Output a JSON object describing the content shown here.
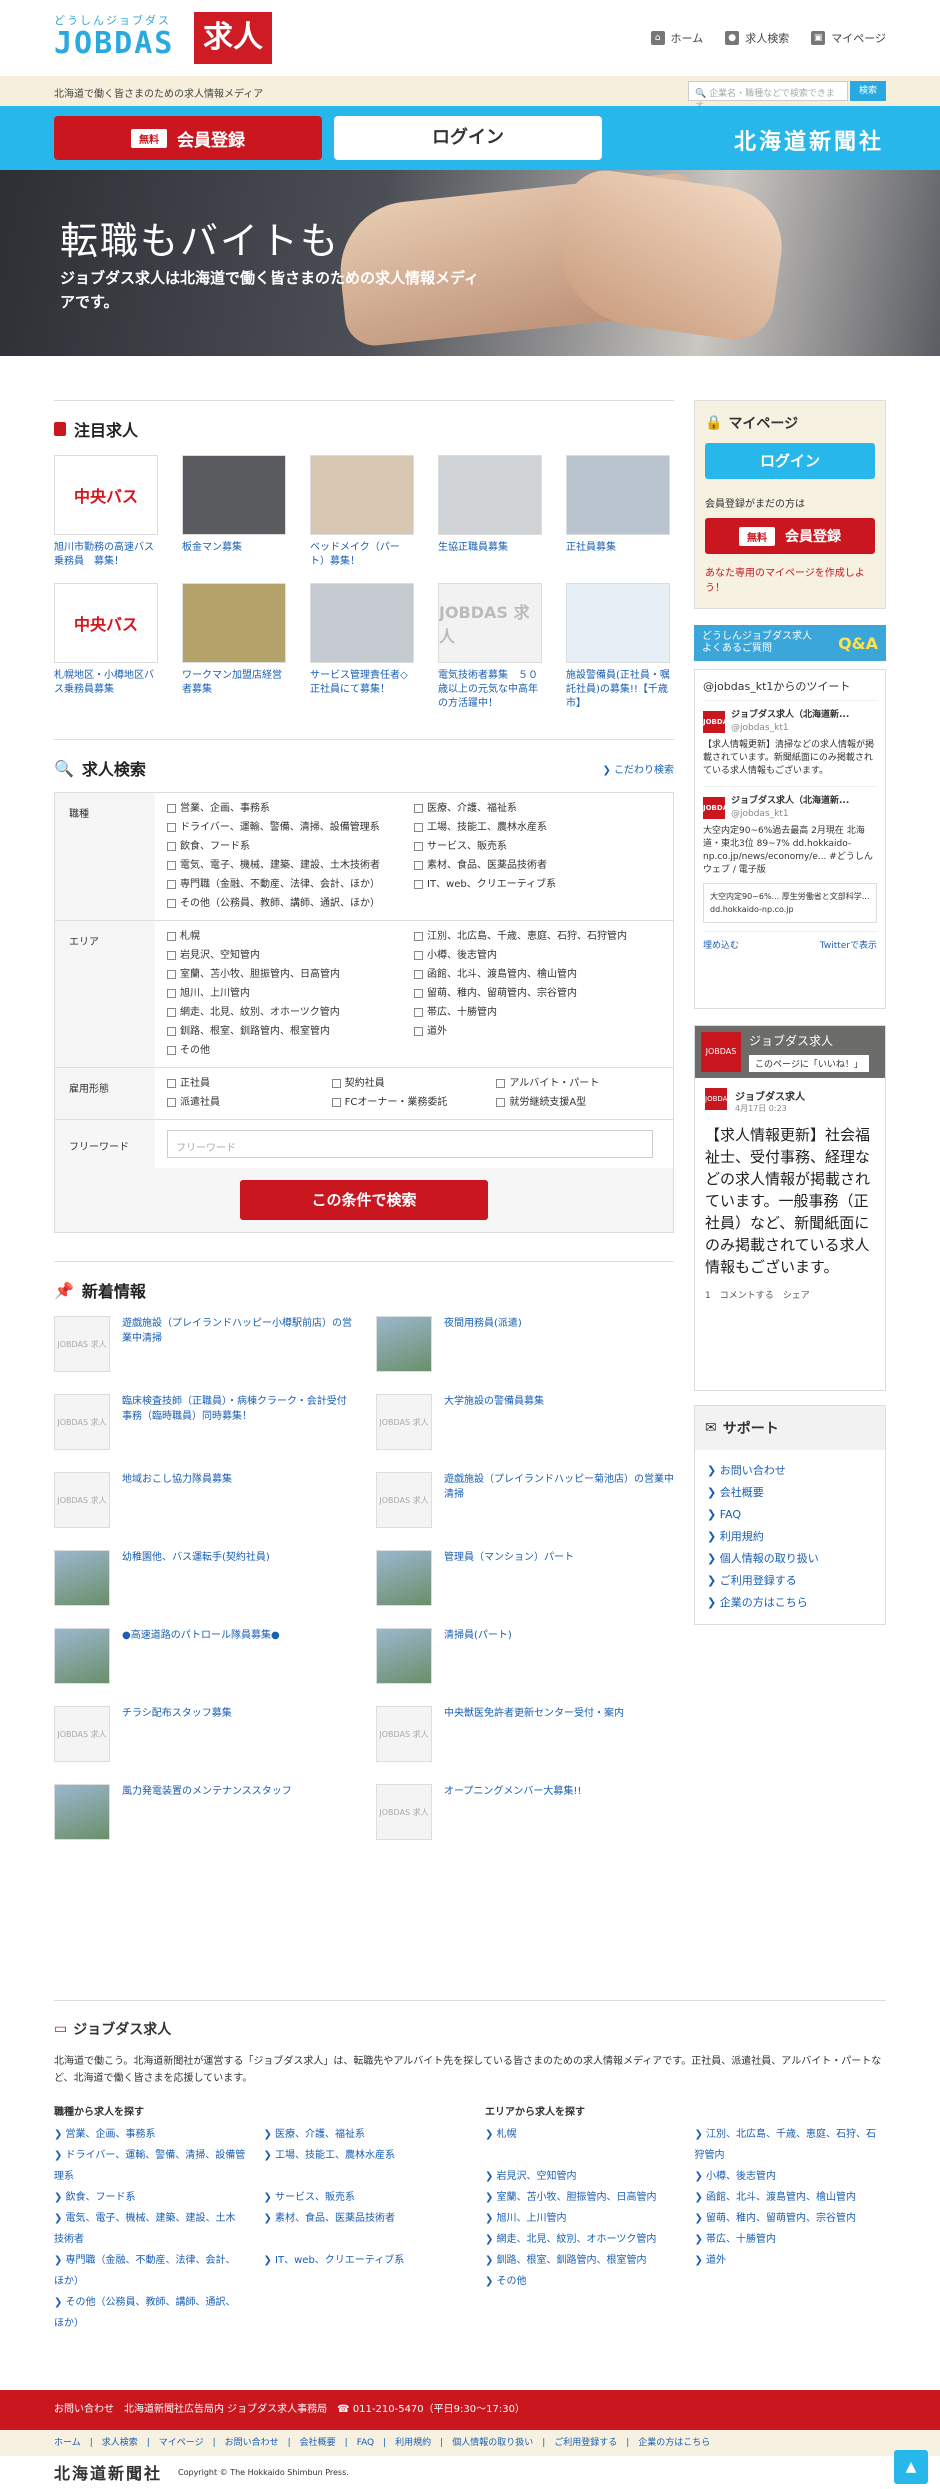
{
  "header": {
    "logo_kana": "どうしんジョブダス",
    "logo_en": "JOBDAS",
    "logo_kyujin": "求人",
    "nav": [
      "ホーム",
      "求人検索",
      "マイページ"
    ],
    "tagline": "北海道で働く皆さまのための求人情報メディア",
    "search_placeholder": "企業名・職種などで検索できます",
    "search_btn": "検索"
  },
  "bar": {
    "free": "無料",
    "register": "会員登録",
    "login": "ログイン",
    "press": "北海道新聞社"
  },
  "hero": {
    "title": "転職もバイトも",
    "text": "ジョブダス求人は北海道で働く皆さまのための求人情報メディアです。"
  },
  "featured": {
    "title": "注目求人",
    "items": [
      {
        "thumb": "中央バス",
        "cap": "旭川市勤務の高速バス乗務員　募集！"
      },
      {
        "thumb": "",
        "cap": "板金マン募集"
      },
      {
        "thumb": "",
        "cap": "ベッドメイク（パート）募集！"
      },
      {
        "thumb": "",
        "cap": "生協正職員募集"
      },
      {
        "thumb": "",
        "cap": "正社員募集"
      },
      {
        "thumb": "中央バス",
        "cap": "札幌地区・小樽地区バス乗務員募集"
      },
      {
        "thumb": "",
        "cap": "ワークマン加盟店経営者募集"
      },
      {
        "thumb": "",
        "cap": "サービス管理責任者◇正社員にて募集！"
      },
      {
        "thumb": "JOBDAS 求人",
        "cap": "電気技術者募集　５０歳以上の元気な中高年の方活躍中！"
      },
      {
        "thumb": "",
        "cap": "施設警備員(正社員・嘱託社員)の募集!!【千歳市】"
      }
    ]
  },
  "search": {
    "title": "求人検索",
    "more": "こだわり検索",
    "job_label": "職種",
    "jobs": [
      "営業、企画、事務系",
      "医療、介護、福祉系",
      "ドライバー、運輸、警備、清掃、設備管理系",
      "工場、技能工、農林水産系",
      "飲食、フード系",
      "サービス、販売系",
      "電気、電子、機械、建築、建設、土木技術者",
      "素材、食品、医薬品技術者",
      "専門職（金融、不動産、法律、会計、ほか）",
      "IT、web、クリエーティブ系",
      "その他（公務員、教師、講師、通訳、ほか）"
    ],
    "area_label": "エリア",
    "areas": [
      "札幌",
      "江別、北広島、千歳、恵庭、石狩、石狩管内",
      "岩見沢、空知管内",
      "小樽、後志管内",
      "室蘭、苫小牧、胆振管内、日高管内",
      "函館、北斗、渡島管内、檜山管内",
      "旭川、上川管内",
      "留萌、稚内、留萌管内、宗谷管内",
      "網走、北見、紋別、オホーツク管内",
      "帯広、十勝管内",
      "釧路、根室、釧路管内、根室管内",
      "道外",
      "その他"
    ],
    "emp_label": "雇用形態",
    "emps": [
      "正社員",
      "契約社員",
      "アルバイト・パート",
      "派遣社員",
      "FCオーナー・業務委託",
      "就労継続支援A型"
    ],
    "fw_label": "フリーワード",
    "fw_placeholder": "フリーワード",
    "button": "この条件で検索"
  },
  "news": {
    "title": "新着情報",
    "items": [
      "遊戯施設（プレイランドハッピー小樽駅前店）の営業中清掃",
      "夜間用務員(派遣)",
      "臨床検査技師（正職員）・病棟クラーク・会計受付事務（臨時職員）同時募集！",
      "大学施設の警備員募集",
      "地域おこし協力隊員募集",
      "遊戯施設（プレイランドハッピー菊池店）の営業中清掃",
      "幼稚園他、バス運転手(契約社員)",
      "管理員（マンション）パート",
      "●高速道路のパトロール隊員募集●",
      "清掃員(パート)",
      "チラシ配布スタッフ募集",
      "中央獣医免許者更新センター受付・案内",
      "風力発電装置のメンテナンススタッフ",
      "オープニングメンバー大募集!!"
    ]
  },
  "side": {
    "mypage": "マイページ",
    "login": "ログイン",
    "not_member": "会員登録がまだの方は",
    "free": "無料",
    "register": "会員登録",
    "note": "あなた専用のマイページを作成しよう！",
    "qa_small": "どうしんジョブダス求人 よくあるご質問",
    "qa": "Q&A",
    "tw_head": "@jobdas_kt1からのツイート",
    "tw_name": "ジョブダス求人（北海道新...",
    "tw_handle": "@jobdas_kt1",
    "tw_text1": "【求人情報更新】清掃などの求人情報が掲載されています。新聞紙面にのみ掲載されている求人情報もございます。",
    "tw_text2": "大空内定90~6%過去最高 2月現在 北海道・東北3位 89~7% dd.hokkaido-np.co.jp/news/economy/e... #どうしんウェブ / 電子版",
    "tw_card": "大空内定90~6%... 厚生労働省と文部科学... dd.hokkaido-np.co.jp",
    "tw_embed": "埋め込む",
    "tw_view": "Twitterで表示",
    "fb_name": "ジョブダス求人",
    "fb_like": "このページに「いいね！」",
    "fb_post_name": "ジョブダス求人",
    "fb_date": "4月17日 0:23",
    "fb_text": "【求人情報更新】社会福祉士、受付事務、経理などの求人情報が掲載されています。一般事務（正社員）など、新聞紙面にのみ掲載されている求人情報もございます。",
    "fb_actions": "1　コメントする　シェア",
    "support": "サポート",
    "links": [
      "お問い合わせ",
      "会社概要",
      "FAQ",
      "利用規約",
      "個人情報の取り扱い",
      "ご利用登録する",
      "企業の方はこちら"
    ]
  },
  "footer": {
    "title": "ジョブダス求人",
    "desc": "北海道で働こう。北海道新聞社が運営する「ジョブダス求人」は、転職先やアルバイト先を探している皆さまのための求人情報メディアです。正社員、派遣社員、アルバイト・パートなど、北海道で働く皆さまを応援しています。",
    "jobs_h": "職種から求人を探す",
    "area_h": "エリアから求人を探す",
    "contact": "お問い合わせ　北海道新聞社広告局内 ジョブダス求人事務局　☎ 011-210-5470（平日9:30〜17:30）",
    "links": "ホーム　|　求人検索　|　マイページ　|　お問い合わせ　|　会社概要　|　FAQ　|　利用規約　|　個人情報の取り扱い　|　ご利用登録する　|　企業の方はこちら",
    "press": "北海道新聞社",
    "copyright": "Copyright © The Hokkaido Shimbun Press."
  }
}
